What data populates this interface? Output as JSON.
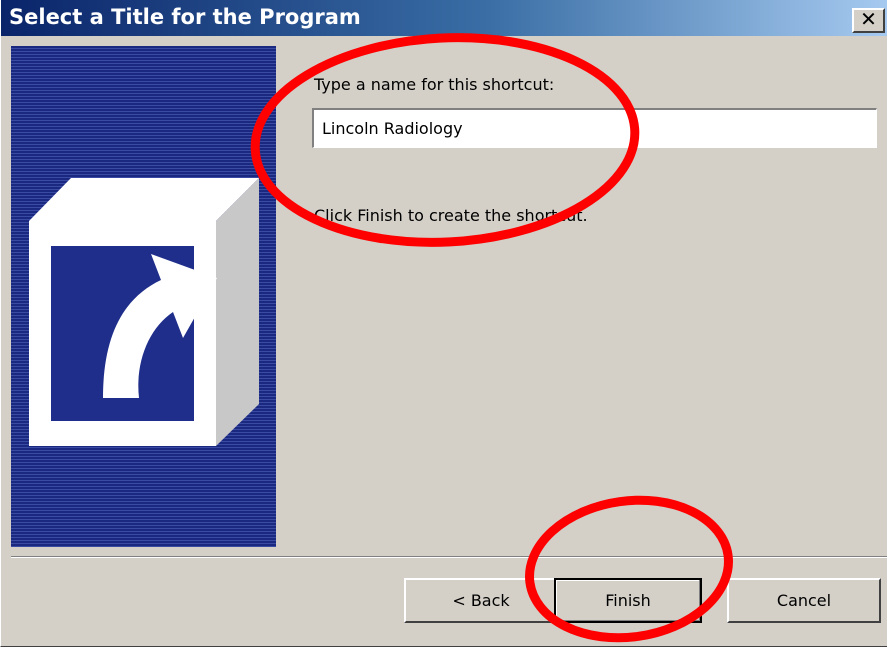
{
  "window": {
    "title": "Select a Title for the Program",
    "close_label": "✕"
  },
  "content": {
    "prompt_label": "Type a name for this shortcut:",
    "shortcut_name": "Lincoln Radiology",
    "instruction": "Click Finish to create the shortcut."
  },
  "buttons": {
    "back_label": "< Back",
    "finish_label": "Finish",
    "cancel_label": "Cancel"
  },
  "icons": {
    "side_panel": "shortcut-arrow-icon"
  },
  "colors": {
    "title_bar": "#0a246a",
    "side_panel": "#1f2e8a",
    "annotation": "#ff0000",
    "dialog_face": "#d4d0c8"
  }
}
